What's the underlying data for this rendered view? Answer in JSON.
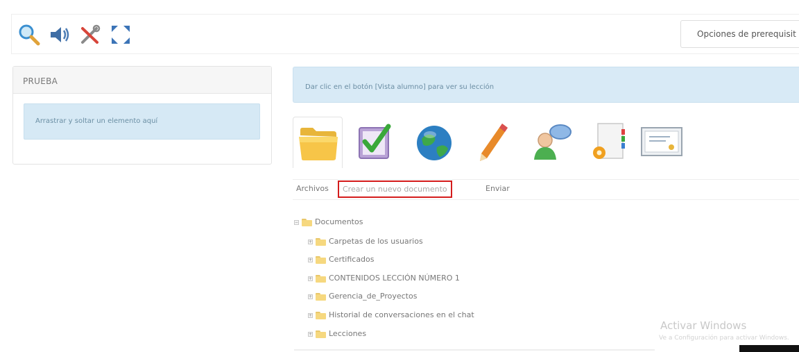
{
  "toolbar": {
    "icons": [
      "search-icon",
      "speaker-icon",
      "tools-icon",
      "fullscreen-icon"
    ],
    "prerequisites_label": "Opciones de prerequisit"
  },
  "panel": {
    "title": "PRUEBA",
    "dropzone_text": "Arrastrar y soltar un elemento aquí"
  },
  "info_message": "Dar clic en el botón [Vista alumno] para ver su lección",
  "tools": [
    "folder-icon",
    "checklist-icon",
    "globe-icon",
    "pencil-icon",
    "users-chat-icon",
    "document-gear-icon",
    "certificate-icon"
  ],
  "tabs": {
    "files": "Archivos",
    "new_document": "Crear un nuevo documento",
    "send": "Enviar"
  },
  "tree": {
    "root": "Documentos",
    "children": [
      "Carpetas de los usuarios",
      "Certificados",
      "CONTENIDOS LECCIÓN NÚMERO 1",
      "Gerencia_de_Proyectos",
      "Historial de conversaciones en el chat",
      "Lecciones"
    ]
  },
  "watermark": {
    "title": "Activar Windows",
    "subtitle": "Ve a Configuración para activar Windows."
  },
  "colors": {
    "info_bg": "#d8eaf6",
    "highlight_border": "#d41c1c",
    "folder": "#f6d87f"
  }
}
